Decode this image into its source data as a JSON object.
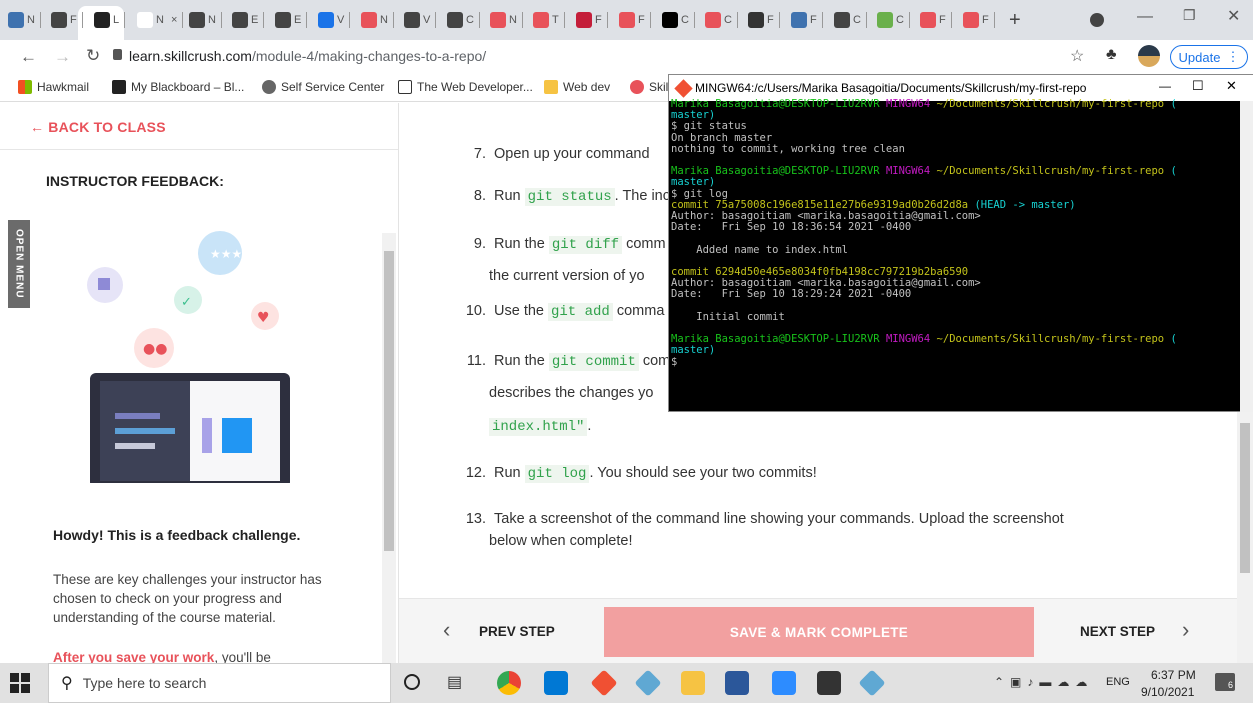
{
  "browser": {
    "tabs": [
      {
        "icon": "tab-icon-blue",
        "letter": "N",
        "color": "#3f72af"
      },
      {
        "icon": "tab-icon-github",
        "letter": "F",
        "color": "#444444"
      },
      {
        "icon": "tab-icon-skillcrush",
        "letter": "L",
        "color": "#222222"
      },
      {
        "icon": "tab-icon-m",
        "letter": "N",
        "color": "#ffffff"
      },
      {
        "icon": "tab-icon-github",
        "letter": "N",
        "color": "#444444"
      },
      {
        "icon": "tab-icon-github",
        "letter": "E",
        "color": "#444444"
      },
      {
        "icon": "tab-icon-github",
        "letter": "E",
        "color": "#444444"
      },
      {
        "icon": "tab-icon-drive",
        "letter": "V",
        "color": "#1a73e8"
      },
      {
        "icon": "tab-icon-red",
        "letter": "N",
        "color": "#e8525a"
      },
      {
        "icon": "tab-icon-github",
        "letter": "V",
        "color": "#444444"
      },
      {
        "icon": "tab-icon-github",
        "letter": "C",
        "color": "#444444"
      },
      {
        "icon": "tab-icon-red",
        "letter": "N",
        "color": "#e8525a"
      },
      {
        "icon": "tab-icon-red",
        "letter": "T",
        "color": "#e8525a"
      },
      {
        "icon": "tab-icon-red",
        "letter": "F",
        "color": "#c41e3a"
      },
      {
        "icon": "tab-icon-red",
        "letter": "F",
        "color": "#e8525a"
      },
      {
        "icon": "tab-icon-dev",
        "letter": "C",
        "color": "#000000"
      },
      {
        "icon": "tab-icon-red",
        "letter": "C",
        "color": "#e8525a"
      },
      {
        "icon": "tab-icon-bird",
        "letter": "F",
        "color": "#333333"
      },
      {
        "icon": "tab-icon-blue",
        "letter": "F",
        "color": "#3f72af"
      },
      {
        "icon": "tab-icon-w",
        "letter": "C",
        "color": "#444444"
      },
      {
        "icon": "tab-icon-green",
        "letter": "C",
        "color": "#6ab04c"
      },
      {
        "icon": "tab-icon-h",
        "letter": "F",
        "color": "#e8525a"
      },
      {
        "icon": "tab-icon-h",
        "letter": "F",
        "color": "#e8525a"
      }
    ],
    "active_tab_label": "×",
    "new_tab": "+",
    "url_domain": "learn.skillcrush.com",
    "url_path": "/module-4/making-changes-to-a-repo/",
    "update_label": "Update",
    "bookmarks": [
      "Hawkmail",
      "My Blackboard – Bl...",
      "Self Service Center",
      "The Web Developer...",
      "Web dev",
      "Skil"
    ]
  },
  "left_panel": {
    "back_label": "← BACK TO CLASS",
    "open_menu_label": "OPEN MENU",
    "feedback_title": "INSTRUCTOR FEEDBACK:",
    "howdy": "Howdy! This is a feedback challenge.",
    "description": "These are key challenges your instructor has chosen to check on your progress and understanding of the course material.",
    "after_bold": "After you save your work",
    "after_rest": ", you'll be"
  },
  "steps": [
    {
      "num": "7.",
      "pre": "Open up your command",
      "code": "",
      "post": ""
    },
    {
      "num": "8.",
      "pre": "Run ",
      "code": "git status",
      "post": ". The inc"
    },
    {
      "num": "9.",
      "pre": "Run the ",
      "code": "git diff",
      "post": " comm"
    },
    {
      "num": "10.",
      "pre": "Use the ",
      "code": "git add",
      "post": " comma"
    },
    {
      "num": "11.",
      "pre": "Run the ",
      "code": "git commit",
      "post": " com"
    },
    {
      "num": "12.",
      "pre": "Run ",
      "code": "git log",
      "post": ". You should see your two commits!"
    }
  ],
  "step9_cont": "the current version of yo",
  "step11_cont": "describes the changes yo",
  "step11_code_cont": "index.html\"",
  "step11_dot": ".",
  "step13": {
    "num": "13.",
    "line1": "Take a screenshot of the command line showing your commands. Upload the screenshot",
    "line2": "below when complete!"
  },
  "footer": {
    "prev_label": "PREV STEP",
    "save_label": "SAVE & MARK COMPLETE",
    "next_label": "NEXT STEP",
    "prev_icon": "‹",
    "next_icon": "›"
  },
  "terminal": {
    "title": "MINGW64:/c/Users/Marika Basagoitia/Documents/Skillcrush/my-first-repo",
    "user_host": "Marika Basagoitia@DESKTOP-LIU2RVR",
    "mingw": "MINGW64",
    "path": "~/Documents/Skillcrush/my-first-repo",
    "branch": "master)",
    "paren": "(",
    "cmd1": "$ git status",
    "out1a": "On branch master",
    "out1b": "nothing to commit, working tree clean",
    "cmd2": "$ git log",
    "commit1": "commit 75a75008c196e815e11e27b6e9319ad0b26d2d8a",
    "head": "(HEAD -> master)",
    "author1": "Author: basagoitiam <marika.basagoitia@gmail.com>",
    "date1": "Date:   Fri Sep 10 18:36:54 2021 -0400",
    "msg1": "    Added name to index.html",
    "commit2": "commit 6294d50e465e8034f0fb4198cc797219b2ba6590",
    "author2": "Author: basagoitiam <marika.basagoitia@gmail.com>",
    "date2": "Date:   Fri Sep 10 18:29:24 2021 -0400",
    "msg2": "    Initial commit",
    "prompt": "$"
  },
  "taskbar": {
    "search_placeholder": "Type here to search",
    "lang": "ENG",
    "time": "6:37 PM",
    "date": "9/10/2021",
    "notif_count": "6"
  }
}
